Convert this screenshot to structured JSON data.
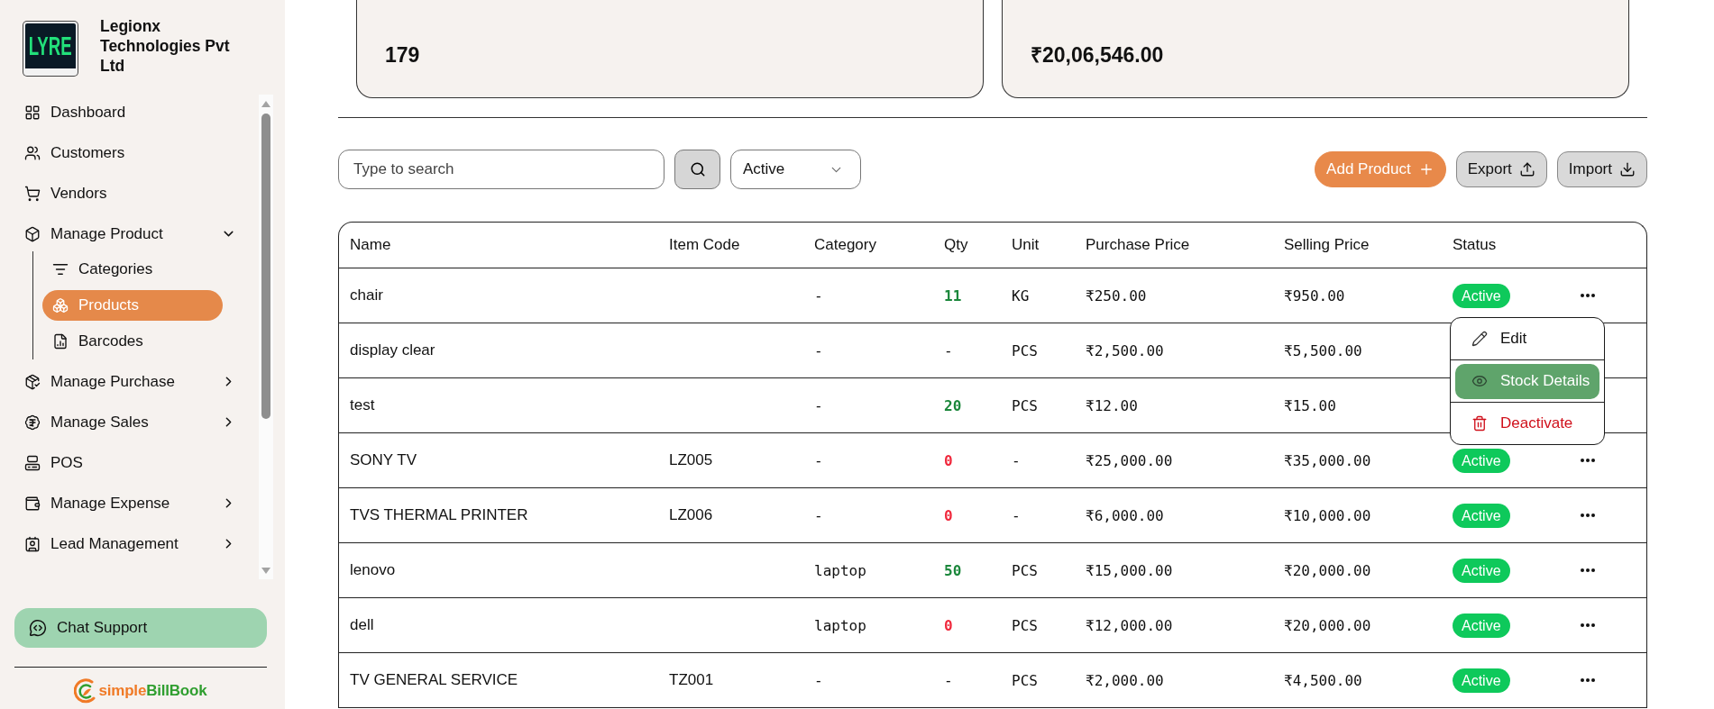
{
  "sidebar": {
    "company": {
      "logo_text": "LYRE",
      "name": "Legionx Technologies Pvt Ltd"
    },
    "nav": [
      {
        "label": "Dashboard",
        "kind": "link",
        "selected": false
      },
      {
        "label": "Customers",
        "kind": "link",
        "selected": false
      },
      {
        "label": "Vendors",
        "kind": "link",
        "selected": false
      },
      {
        "label": "Manage Product",
        "kind": "group",
        "selected": false,
        "expanded": true,
        "children": [
          {
            "label": "Categories",
            "selected": false
          },
          {
            "label": "Products",
            "selected": true
          },
          {
            "label": "Barcodes",
            "selected": false
          }
        ]
      },
      {
        "label": "Manage Purchase",
        "kind": "group",
        "selected": false,
        "expanded": false
      },
      {
        "label": "Manage Sales",
        "kind": "group",
        "selected": false,
        "expanded": false
      },
      {
        "label": "POS",
        "kind": "link",
        "selected": false
      },
      {
        "label": "Manage Expense",
        "kind": "group",
        "selected": false,
        "expanded": false
      },
      {
        "label": "Lead Management",
        "kind": "group",
        "selected": false,
        "expanded": false
      }
    ],
    "chat_button": "Chat Support",
    "brand": {
      "prefix": "simple",
      "suffix": "BillBook"
    }
  },
  "stats": [
    {
      "value": "179"
    },
    {
      "value": "₹20,06,546.00"
    }
  ],
  "toolbar": {
    "search": {
      "placeholder": "Type to search"
    },
    "status_filter": {
      "value": "Active"
    },
    "buttons": [
      {
        "label": "Add Product",
        "kind": "add"
      },
      {
        "label": "Export",
        "kind": "export"
      },
      {
        "label": "Import",
        "kind": "import"
      }
    ]
  },
  "table": {
    "columns": [
      "Name",
      "Item Code",
      "Category",
      "Qty",
      "Unit",
      "Purchase Price",
      "Selling Price",
      "Status"
    ],
    "rows": [
      {
        "name": "chair",
        "category": "-",
        "qty": {
          "text": "11",
          "color": "#1b873b"
        },
        "unit": "KG",
        "purchase_price": "₹250.00",
        "selling_price": "₹950.00",
        "status": "Active"
      },
      {
        "name": "display clear",
        "category": "-",
        "qty": {
          "text": "-"
        },
        "unit": "PCS",
        "purchase_price": "₹2,500.00",
        "selling_price": "₹5,500.00"
      },
      {
        "name": "test",
        "category": "-",
        "qty": {
          "text": "20",
          "color": "#1b873b"
        },
        "unit": "PCS",
        "purchase_price": "₹12.00",
        "selling_price": "₹15.00"
      },
      {
        "name": "SONY TV",
        "item_code": "LZ005",
        "category": "-",
        "qty": {
          "text": "0",
          "color": "#f0283c"
        },
        "unit": "-",
        "purchase_price": "₹25,000.00",
        "selling_price": "₹35,000.00",
        "status": "Active"
      },
      {
        "name": "TVS THERMAL PRINTER",
        "item_code": "LZ006",
        "category": "-",
        "qty": {
          "text": "0",
          "color": "#f0283c"
        },
        "unit": "-",
        "purchase_price": "₹6,000.00",
        "selling_price": "₹10,000.00",
        "status": "Active"
      },
      {
        "name": "lenovo",
        "category": "laptop",
        "qty": {
          "text": "50",
          "color": "#1b873b"
        },
        "unit": "PCS",
        "purchase_price": "₹15,000.00",
        "selling_price": "₹20,000.00",
        "status": "Active"
      },
      {
        "name": "dell",
        "category": "laptop",
        "qty": {
          "text": "0",
          "color": "#f0283c"
        },
        "unit": "PCS",
        "purchase_price": "₹12,000.00",
        "selling_price": "₹20,000.00",
        "status": "Active"
      },
      {
        "name": "TV GENERAL SERVICE",
        "item_code": "TZ001",
        "category": "-",
        "qty": {
          "text": "-"
        },
        "unit": "PCS",
        "purchase_price": "₹2,000.00",
        "selling_price": "₹4,500.00",
        "status": "Active"
      }
    ],
    "row_menu": {
      "items": [
        {
          "label": "Edit",
          "kind": "edit",
          "selected": false
        },
        {
          "label": "Stock Details",
          "kind": "view",
          "selected": true
        },
        {
          "label": "Deactivate",
          "kind": "delete",
          "selected": false
        }
      ]
    }
  }
}
